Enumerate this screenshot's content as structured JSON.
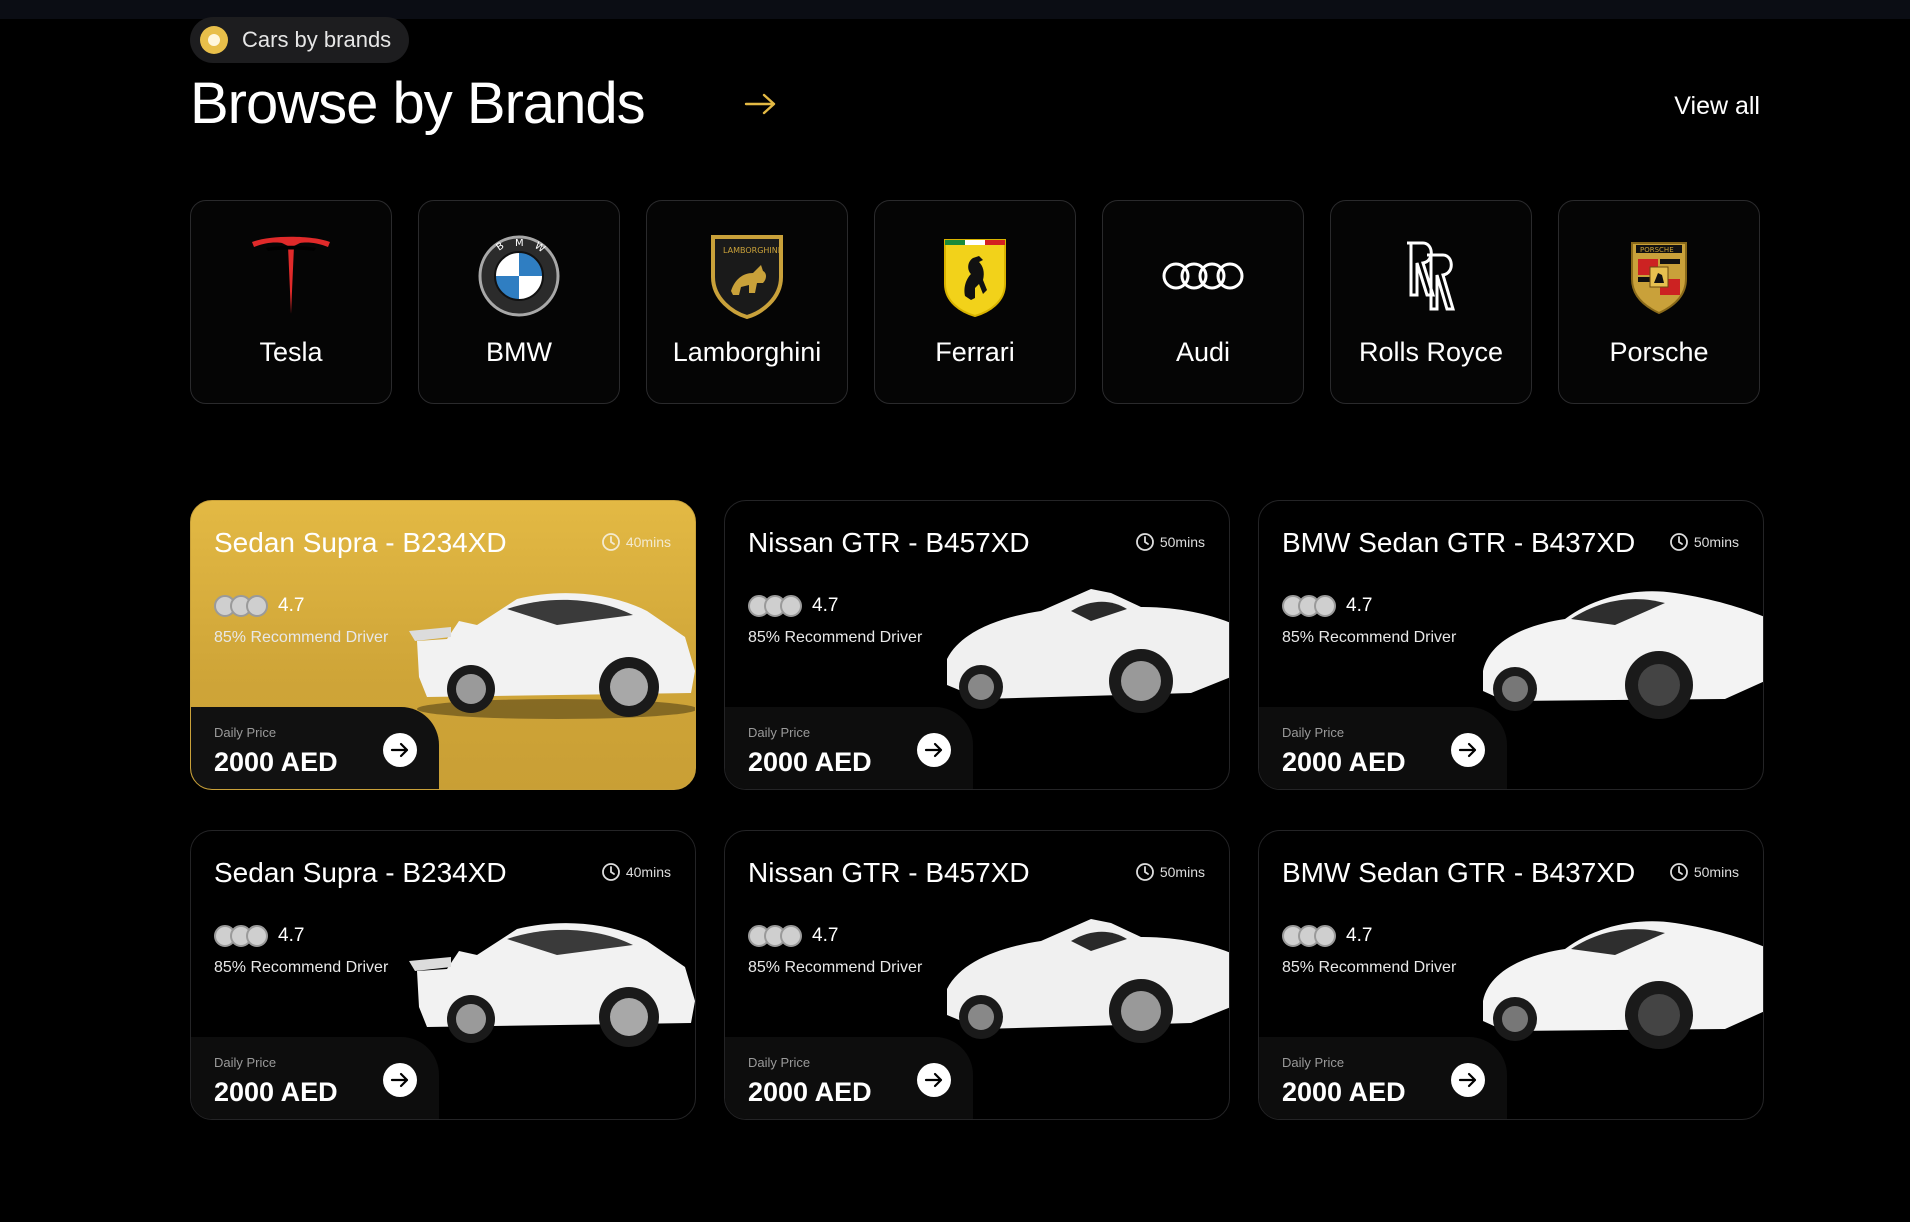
{
  "section_tag": {
    "label": "Cars by brands"
  },
  "header": {
    "title": "Browse by Brands",
    "view_all": "View all"
  },
  "brands": [
    {
      "name": "Tesla",
      "icon": "tesla-logo"
    },
    {
      "name": "BMW",
      "icon": "bmw-logo"
    },
    {
      "name": "Lamborghini",
      "icon": "lamborghini-logo"
    },
    {
      "name": "Ferrari",
      "icon": "ferrari-logo"
    },
    {
      "name": "Audi",
      "icon": "audi-logo"
    },
    {
      "name": "Rolls Royce",
      "icon": "rolls-royce-logo"
    },
    {
      "name": "Porsche",
      "icon": "porsche-logo"
    }
  ],
  "cars": [
    {
      "title": "Sedan Supra - B234XD",
      "time": "40mins",
      "rating": "4.7",
      "recommend": "85% Recommend Driver",
      "price_label": "Daily Price",
      "price": "2000 AED",
      "highlighted": true
    },
    {
      "title": "Nissan GTR - B457XD",
      "time": "50mins",
      "rating": "4.7",
      "recommend": "85% Recommend Driver",
      "price_label": "Daily Price",
      "price": "2000 AED",
      "highlighted": false
    },
    {
      "title": "BMW Sedan GTR - B437XD",
      "time": "50mins",
      "rating": "4.7",
      "recommend": "85% Recommend Driver",
      "price_label": "Daily Price",
      "price": "2000 AED",
      "highlighted": false
    },
    {
      "title": "Sedan Supra - B234XD",
      "time": "40mins",
      "rating": "4.7",
      "recommend": "85% Recommend Driver",
      "price_label": "Daily Price",
      "price": "2000 AED",
      "highlighted": false
    },
    {
      "title": "Nissan GTR - B457XD",
      "time": "50mins",
      "rating": "4.7",
      "recommend": "85% Recommend Driver",
      "price_label": "Daily Price",
      "price": "2000 AED",
      "highlighted": false
    },
    {
      "title": "BMW Sedan GTR - B437XD",
      "time": "50mins",
      "rating": "4.7",
      "recommend": "85% Recommend Driver",
      "price_label": "Daily Price",
      "price": "2000 AED",
      "highlighted": false
    }
  ],
  "colors": {
    "accent": "#e3b944",
    "background": "#000000",
    "card_border": "#242426"
  }
}
